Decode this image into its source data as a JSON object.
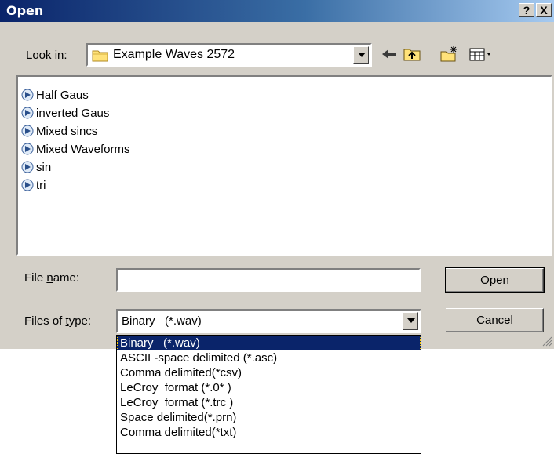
{
  "window": {
    "title": "Open",
    "help_label": "?",
    "close_label": "X"
  },
  "look_in": {
    "label": "Look in:",
    "value": "Example Waves 2572",
    "folder_icon": "folder-icon"
  },
  "toolbar": {
    "back_icon": "back-arrow-icon",
    "up_icon": "up-folder-icon",
    "new_folder_icon": "new-folder-icon",
    "view_icon": "view-menu-icon"
  },
  "files": [
    {
      "name": "Half Gaus",
      "icon": "wave-file-icon"
    },
    {
      "name": "inverted Gaus",
      "icon": "wave-file-icon"
    },
    {
      "name": "Mixed sincs",
      "icon": "wave-file-icon"
    },
    {
      "name": "Mixed Waveforms",
      "icon": "wave-file-icon"
    },
    {
      "name": "sin",
      "icon": "wave-file-icon"
    },
    {
      "name": "tri",
      "icon": "wave-file-icon"
    }
  ],
  "file_name": {
    "label": "File name:",
    "value": ""
  },
  "file_type": {
    "label": "Files of type:",
    "value": "Binary   (*.wav)",
    "options": [
      "Binary   (*.wav)",
      "ASCII -space delimited (*.asc)",
      "Comma delimited(*csv)",
      "LeCroy  format (*.0* )",
      "LeCroy  format (*.trc )",
      "Space delimited(*.prn)",
      "Comma delimited(*txt)"
    ],
    "selected_index": 0
  },
  "buttons": {
    "open": "Open",
    "cancel": "Cancel"
  },
  "colors": {
    "title_gradient_start": "#0a246a",
    "dialog_face": "#d4d0c8",
    "selection": "#0a246a"
  }
}
